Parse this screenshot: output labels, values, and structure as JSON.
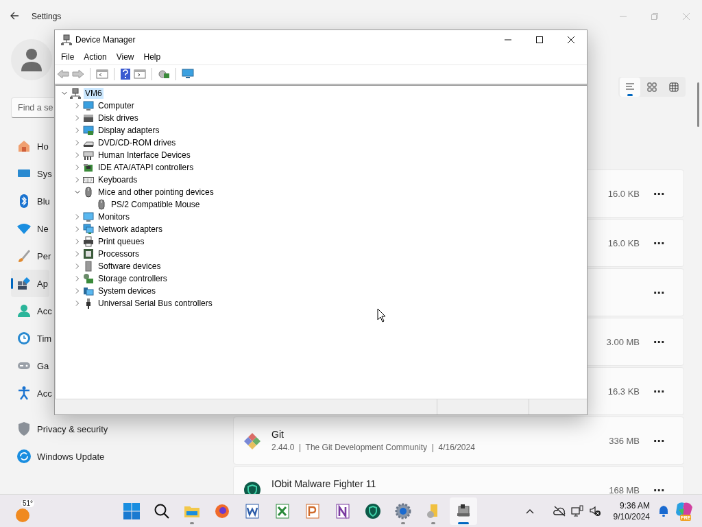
{
  "settings": {
    "title": "Settings",
    "search": {
      "placeholder": "Find a se"
    },
    "nav": [
      {
        "label": "Ho",
        "selected": false
      },
      {
        "label": "Sys",
        "selected": false
      },
      {
        "label": "Blu",
        "selected": false
      },
      {
        "label": "Ne",
        "selected": false
      },
      {
        "label": "Per",
        "selected": false
      },
      {
        "label": "Ap",
        "selected": true
      },
      {
        "label": "Acc",
        "selected": false
      },
      {
        "label": "Tim",
        "selected": false
      },
      {
        "label": "Ga",
        "selected": false
      },
      {
        "label": "Acc",
        "selected": false
      },
      {
        "label": "Privacy & security",
        "selected": false
      },
      {
        "label": "Windows Update",
        "selected": false
      }
    ],
    "view_toggles": [
      {
        "selected": true
      },
      {
        "selected": false
      },
      {
        "selected": false
      }
    ],
    "apps": [
      {
        "size": "16.0 KB",
        "more": "⋯"
      },
      {
        "size": "16.0 KB",
        "more": "⋯"
      },
      {
        "more": "⋯"
      },
      {
        "size": "3.00 MB",
        "more": "⋯"
      },
      {
        "size": "16.3 KB",
        "more": "⋯"
      },
      {
        "name": "Git",
        "details": "2.44.0  |  The Git Development Community  |  4/16/2024",
        "size": "336 MB",
        "more": "⋯"
      },
      {
        "name": "IObit Malware Fighter 11",
        "size": "168 MB",
        "more": "⋯"
      }
    ]
  },
  "device_manager": {
    "title": "Device Manager",
    "menu": [
      "File",
      "Action",
      "View",
      "Help"
    ],
    "tree": {
      "label": "VM6",
      "expanded": true,
      "selected": true,
      "children": [
        {
          "label": "Computer",
          "expanded": false,
          "selected": false
        },
        {
          "label": "Disk drives",
          "expanded": false,
          "selected": false
        },
        {
          "label": "Display adapters",
          "expanded": false,
          "selected": false
        },
        {
          "label": "DVD/CD-ROM drives",
          "expanded": false,
          "selected": false
        },
        {
          "label": "Human Interface Devices",
          "expanded": false,
          "selected": false
        },
        {
          "label": "IDE ATA/ATAPI controllers",
          "expanded": false,
          "selected": false
        },
        {
          "label": "Keyboards",
          "expanded": false,
          "selected": false
        },
        {
          "label": "Mice and other pointing devices",
          "expanded": true,
          "selected": false,
          "children": [
            {
              "label": "PS/2 Compatible Mouse",
              "selected": false
            }
          ]
        },
        {
          "label": "Monitors",
          "expanded": false,
          "selected": false
        },
        {
          "label": "Network adapters",
          "expanded": false,
          "selected": false
        },
        {
          "label": "Print queues",
          "expanded": false,
          "selected": false
        },
        {
          "label": "Processors",
          "expanded": false,
          "selected": false
        },
        {
          "label": "Software devices",
          "expanded": false,
          "selected": false
        },
        {
          "label": "Storage controllers",
          "expanded": false,
          "selected": false
        },
        {
          "label": "System devices",
          "expanded": false,
          "selected": false
        },
        {
          "label": "Universal Serial Bus controllers",
          "expanded": false,
          "selected": false
        }
      ]
    }
  },
  "taskbar": {
    "weather": "51°",
    "apps": [
      {
        "running": true,
        "selected": false
      },
      {
        "running": false,
        "selected": false
      },
      {
        "running": false,
        "selected": false
      },
      {
        "running": false,
        "selected": false
      },
      {
        "running": false,
        "selected": false
      },
      {
        "running": false,
        "selected": false
      },
      {
        "running": false,
        "selected": false
      },
      {
        "running": true,
        "selected": false
      },
      {
        "running": true,
        "selected": false
      },
      {
        "running": true,
        "selected": true
      }
    ],
    "copilot_badge": "PRE",
    "time": "9:36 AM",
    "date": "9/10/2024"
  }
}
